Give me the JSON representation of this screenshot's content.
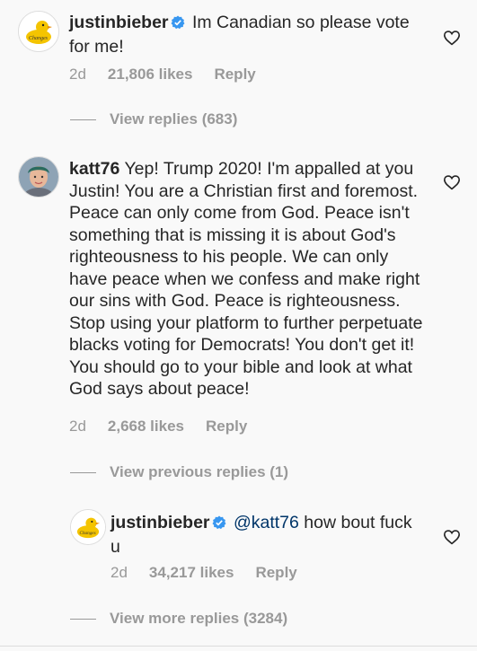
{
  "comments": [
    {
      "user": "justinbieber",
      "verified": true,
      "text": "Im Canadian so please vote for me!",
      "date": "2d",
      "likes": "21,806 likes",
      "reply": "Reply",
      "avatar_text": "Changes"
    },
    {
      "user": "katt76",
      "verified": false,
      "text": "Yep! Trump 2020! I'm appalled at you Justin! You are a Christian first and foremost. Peace can only come from God. Peace isn't something that is missing it is about God's righteousness to his people. We can only have peace when we confess and make right our sins with God. Peace is righteousness. Stop using your platform to further perpetuate blacks voting for Democrats! You don't get it! You should go to your bible and look at what God says about peace!",
      "date": "2d",
      "likes": "2,668 likes",
      "reply": "Reply"
    },
    {
      "user": "justinbieber",
      "verified": true,
      "mention": "@katt76",
      "text": "how bout fuck u",
      "date": "2d",
      "likes": "34,217 likes",
      "reply": "Reply",
      "avatar_text": "Changes"
    }
  ],
  "view_replies_1": "View replies (683)",
  "view_previous_replies": "View previous replies (1)",
  "view_more_replies": "View more replies (3284)",
  "colors": {
    "background": "#f9f9f9",
    "text": "#262626",
    "meta": "#999999",
    "mention": "#003569",
    "verified": "#3897f0"
  }
}
